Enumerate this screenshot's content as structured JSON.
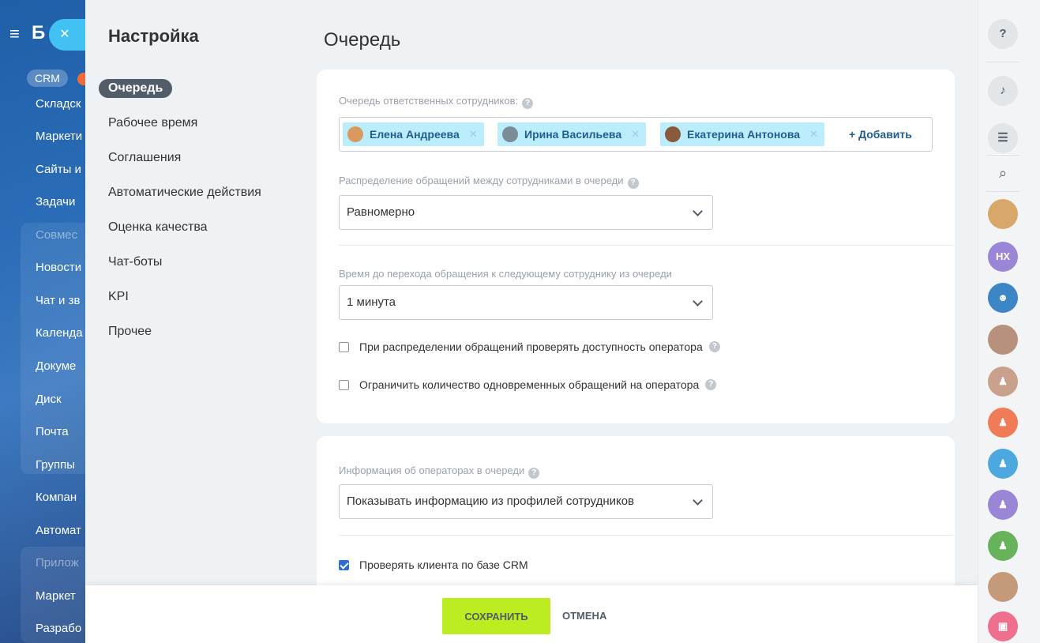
{
  "background_app": {
    "logo": "Б",
    "crm_badge": "CRM",
    "items": [
      {
        "label": "Складск",
        "dim": false
      },
      {
        "label": "Маркети",
        "dim": false
      },
      {
        "label": "Сайты и",
        "dim": false
      },
      {
        "label": "Задачи",
        "dim": false
      },
      {
        "label": "Совмес",
        "dim": true
      },
      {
        "label": "Новости",
        "dim": false
      },
      {
        "label": "Чат и зв",
        "dim": false
      },
      {
        "label": "Календа",
        "dim": false
      },
      {
        "label": "Докуме",
        "dim": false
      },
      {
        "label": "Диск",
        "dim": false
      },
      {
        "label": "Почта",
        "dim": false
      },
      {
        "label": "Группы",
        "dim": false
      },
      {
        "label": "Компан",
        "dim": false
      },
      {
        "label": "Автомат",
        "dim": false
      },
      {
        "label": "Прилож",
        "dim": true
      },
      {
        "label": "Маркет",
        "dim": false
      },
      {
        "label": "Разрабо",
        "dim": false
      }
    ]
  },
  "settings": {
    "title": "Настройка",
    "menu": [
      {
        "label": "Очередь",
        "active": true
      },
      {
        "label": "Рабочее время",
        "active": false
      },
      {
        "label": "Соглашения",
        "active": false
      },
      {
        "label": "Автоматические действия",
        "active": false
      },
      {
        "label": "Оценка качества",
        "active": false
      },
      {
        "label": "Чат-боты",
        "active": false
      },
      {
        "label": "KPI",
        "active": false
      },
      {
        "label": "Прочее",
        "active": false
      }
    ]
  },
  "page": {
    "title": "Очередь",
    "queue": {
      "label": "Очередь ответственных сотрудников:",
      "employees": [
        {
          "name": "Елена Андреева",
          "avatar_color": "#d89a5f"
        },
        {
          "name": "Ирина Васильева",
          "avatar_color": "#7a8c96"
        },
        {
          "name": "Екатерина Антонова",
          "avatar_color": "#8a5a3c"
        }
      ],
      "add_label": "+ Добавить"
    },
    "distribution": {
      "label": "Распределение обращений между сотрудниками в очереди",
      "value": "Равномерно"
    },
    "timeout": {
      "label": "Время до перехода обращения к следующему сотруднику из очереди",
      "value": "1 минута"
    },
    "check_availability": {
      "label": "При распределении обращений проверять доступность оператора",
      "checked": false
    },
    "limit_sessions": {
      "label": "Ограничить количество одновременных обращений на оператора",
      "checked": false
    },
    "operator_info": {
      "label": "Информация об операторах в очереди",
      "value": "Показывать информацию из профилей сотрудников"
    },
    "crm_check": {
      "label": "Проверять клиента по базе CRM",
      "checked": true
    }
  },
  "footer": {
    "save_label": "СОХРАНИТЬ",
    "cancel_label": "ОТМЕНА"
  },
  "rightbar": {
    "help_glyph": "?",
    "user_initials": "HX",
    "avatar_colors": [
      "#d8a86a",
      "#9a86d6",
      "#3d86c6",
      "#b7917c",
      "#c9a08c",
      "#ef7b57",
      "#4da8e0",
      "#9a86d6",
      "#66b35b",
      "#c49a7a",
      "#ef6f8f"
    ]
  },
  "colors": {
    "accent_save": "#bbed21",
    "tag_bg": "#bcedfc",
    "tag_text": "#1f5e90"
  }
}
